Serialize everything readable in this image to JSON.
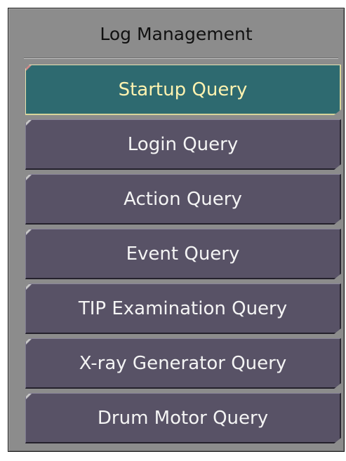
{
  "panel": {
    "title": "Log Management"
  },
  "menu": {
    "items": [
      {
        "label": "Startup Query",
        "active": true
      },
      {
        "label": "Login Query",
        "active": false
      },
      {
        "label": "Action Query",
        "active": false
      },
      {
        "label": "Event Query",
        "active": false
      },
      {
        "label": "TIP Examination Query",
        "active": false
      },
      {
        "label": "X-ray Generator Query",
        "active": false
      },
      {
        "label": "Drum Motor Query",
        "active": false
      }
    ]
  },
  "colors": {
    "panel_background": "#8c8c8c",
    "button_background": "#585266",
    "active_button_background": "#2e6a70",
    "active_label_color": "#fff3b0",
    "label_color": "#f4f4f4"
  }
}
